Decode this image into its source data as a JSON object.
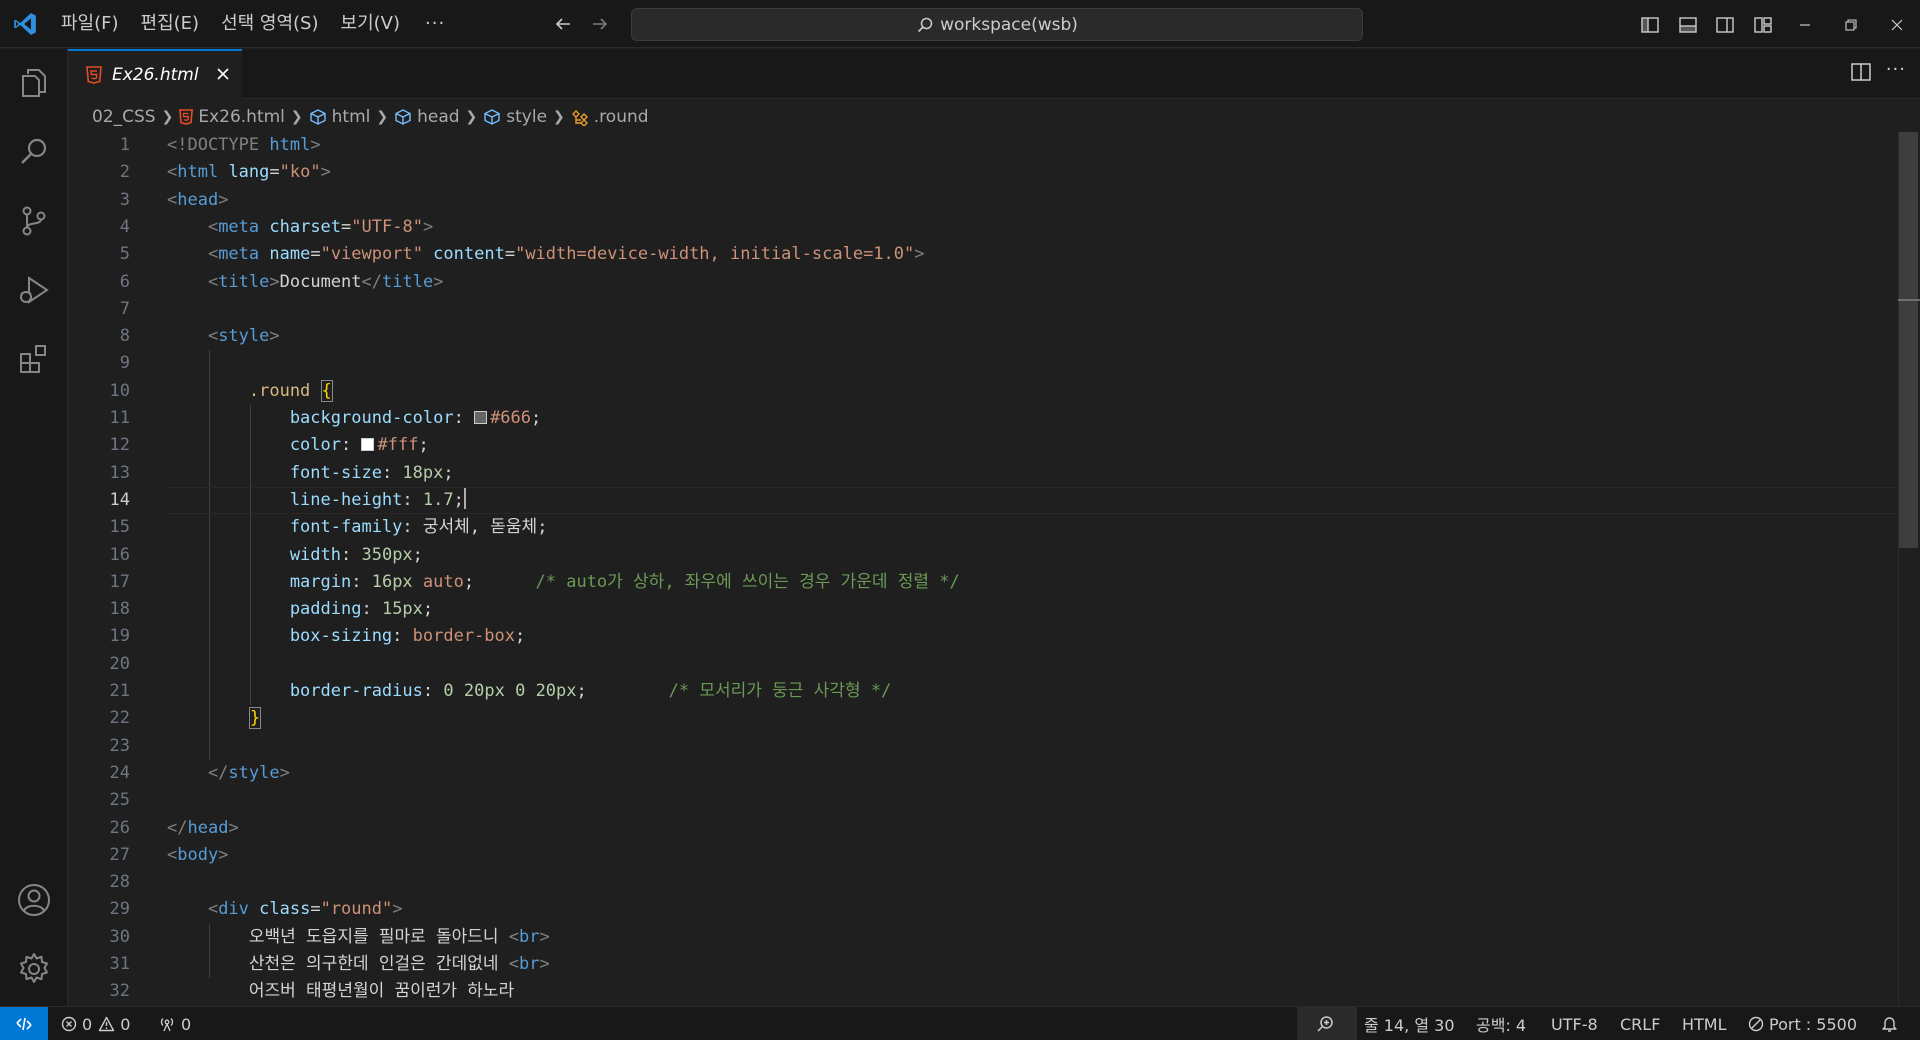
{
  "app": {
    "menus": [
      "파일(F)",
      "편집(E)",
      "선택 영역(S)",
      "보기(V)"
    ],
    "more": "···",
    "search_text": "workspace(wsb)"
  },
  "tab": {
    "label": "Ex26.html",
    "more": "···"
  },
  "breadcrumb": {
    "folder": "02_CSS",
    "file": "Ex26.html",
    "html": "html",
    "head": "head",
    "style": "style",
    "selector": ".round"
  },
  "editor": {
    "active_line": 14,
    "lines": [
      [
        [
          "<!DOCTYPE ",
          "t-br"
        ],
        [
          "html",
          "t-tag"
        ],
        [
          ">",
          "t-br"
        ]
      ],
      [
        [
          "<",
          "t-br"
        ],
        [
          "html",
          "t-tag"
        ],
        [
          " lang",
          "t-attr"
        ],
        [
          "=",
          "t-text"
        ],
        [
          "\"ko\"",
          "t-str"
        ],
        [
          ">",
          "t-br"
        ]
      ],
      [
        [
          "<",
          "t-br"
        ],
        [
          "head",
          "t-tag"
        ],
        [
          ">",
          "t-br"
        ]
      ],
      [
        [
          "    <",
          "t-br"
        ],
        [
          "meta",
          "t-tag"
        ],
        [
          " charset",
          "t-attr"
        ],
        [
          "=",
          "t-text"
        ],
        [
          "\"UTF-8\"",
          "t-str"
        ],
        [
          ">",
          "t-br"
        ]
      ],
      [
        [
          "    <",
          "t-br"
        ],
        [
          "meta",
          "t-tag"
        ],
        [
          " name",
          "t-attr"
        ],
        [
          "=",
          "t-text"
        ],
        [
          "\"viewport\"",
          "t-str"
        ],
        [
          " content",
          "t-attr"
        ],
        [
          "=",
          "t-text"
        ],
        [
          "\"width=device-width, initial-scale=1.0\"",
          "t-str"
        ],
        [
          ">",
          "t-br"
        ]
      ],
      [
        [
          "    <",
          "t-br"
        ],
        [
          "title",
          "t-tag"
        ],
        [
          ">",
          "t-br"
        ],
        [
          "Document",
          "t-text"
        ],
        [
          "</",
          "t-br"
        ],
        [
          "title",
          "t-tag"
        ],
        [
          ">",
          "t-br"
        ]
      ],
      [],
      [
        [
          "    <",
          "t-br"
        ],
        [
          "style",
          "t-tag"
        ],
        [
          ">",
          "t-br"
        ]
      ],
      [],
      [
        [
          "        .round ",
          "t-sel"
        ],
        [
          "{",
          "t-brace t-brace-box"
        ]
      ],
      [
        [
          "            background-color",
          "t-prop"
        ],
        [
          ": ",
          "t-text"
        ],
        [
          "",
          "swatch:#666666"
        ],
        [
          "#666",
          "t-str"
        ],
        [
          ";",
          "t-text"
        ]
      ],
      [
        [
          "            color",
          "t-prop"
        ],
        [
          ": ",
          "t-text"
        ],
        [
          "",
          "swatch:#ffffff"
        ],
        [
          "#fff",
          "t-str"
        ],
        [
          ";",
          "t-text"
        ]
      ],
      [
        [
          "            font-size",
          "t-prop"
        ],
        [
          ": ",
          "t-text"
        ],
        [
          "18px",
          "t-num"
        ],
        [
          ";",
          "t-text"
        ]
      ],
      [
        [
          "            line-height",
          "t-prop"
        ],
        [
          ": ",
          "t-text"
        ],
        [
          "1.7",
          "t-num"
        ],
        [
          ";",
          "t-text"
        ],
        [
          "",
          "cursor"
        ]
      ],
      [
        [
          "            font-family",
          "t-prop"
        ],
        [
          ": ",
          "t-text"
        ],
        [
          "궁서체, 돋움체",
          "t-text"
        ],
        [
          ";",
          "t-text"
        ]
      ],
      [
        [
          "            width",
          "t-prop"
        ],
        [
          ": ",
          "t-text"
        ],
        [
          "350px",
          "t-num"
        ],
        [
          ";",
          "t-text"
        ]
      ],
      [
        [
          "            margin",
          "t-prop"
        ],
        [
          ": ",
          "t-text"
        ],
        [
          "16px",
          "t-num"
        ],
        [
          " auto",
          "t-str"
        ],
        [
          ";",
          "t-text"
        ],
        [
          "      /* auto가 상하, 좌우에 쓰이는 경우 가운데 정렬 */",
          "t-cmt"
        ]
      ],
      [
        [
          "            padding",
          "t-prop"
        ],
        [
          ": ",
          "t-text"
        ],
        [
          "15px",
          "t-num"
        ],
        [
          ";",
          "t-text"
        ]
      ],
      [
        [
          "            box-sizing",
          "t-prop"
        ],
        [
          ": ",
          "t-text"
        ],
        [
          "border-box",
          "t-str"
        ],
        [
          ";",
          "t-text"
        ]
      ],
      [],
      [
        [
          "            border-radius",
          "t-prop"
        ],
        [
          ": ",
          "t-text"
        ],
        [
          "0",
          "t-num"
        ],
        [
          " ",
          "t-text"
        ],
        [
          "20px",
          "t-num"
        ],
        [
          " ",
          "t-text"
        ],
        [
          "0",
          "t-num"
        ],
        [
          " ",
          "t-text"
        ],
        [
          "20px",
          "t-num"
        ],
        [
          ";",
          "t-text"
        ],
        [
          "        /* 모서리가 둥근 사각형 */",
          "t-cmt"
        ]
      ],
      [
        [
          "        ",
          "t-text"
        ],
        [
          "}",
          "t-brace t-brace-box"
        ]
      ],
      [],
      [
        [
          "    </",
          "t-br"
        ],
        [
          "style",
          "t-tag"
        ],
        [
          ">",
          "t-br"
        ]
      ],
      [],
      [
        [
          "</",
          "t-br"
        ],
        [
          "head",
          "t-tag"
        ],
        [
          ">",
          "t-br"
        ]
      ],
      [
        [
          "<",
          "t-br"
        ],
        [
          "body",
          "t-tag"
        ],
        [
          ">",
          "t-br"
        ]
      ],
      [],
      [
        [
          "    <",
          "t-br"
        ],
        [
          "div",
          "t-tag"
        ],
        [
          " class",
          "t-attr"
        ],
        [
          "=",
          "t-text"
        ],
        [
          "\"round\"",
          "t-str"
        ],
        [
          ">",
          "t-br"
        ]
      ],
      [
        [
          "        오백년 도읍지를 필마로 돌아드니 ",
          "t-text"
        ],
        [
          "<",
          "t-br"
        ],
        [
          "br",
          "t-tag"
        ],
        [
          ">",
          "t-br"
        ]
      ],
      [
        [
          "        산천은 의구한데 인걸은 간데없네 ",
          "t-text"
        ],
        [
          "<",
          "t-br"
        ],
        [
          "br",
          "t-tag"
        ],
        [
          ">",
          "t-br"
        ]
      ],
      [
        [
          "        어즈버 태평년월이 꿈이런가 하노라",
          "t-text"
        ]
      ]
    ]
  },
  "status": {
    "errors": "0",
    "warnings": "0",
    "ports": "0",
    "position": "줄 14, 열 30",
    "spaces": "공백: 4",
    "encoding": "UTF-8",
    "eol": "CRLF",
    "language": "HTML",
    "port": "Port : 5500"
  },
  "colors": {
    "accent": "#0078d4",
    "background": "#1f1f1f",
    "html_icon": "#e44d26",
    "selector_icon": "#ee9d28"
  },
  "icons": [
    "vscode-logo-icon",
    "arrow-left-icon",
    "arrow-right-icon",
    "search-icon",
    "files-icon",
    "source-control-icon",
    "run-debug-icon",
    "extensions-icon",
    "account-icon",
    "settings-gear-icon",
    "html-file-icon",
    "symbol-class-icon",
    "remote-icon",
    "error-icon",
    "warning-icon",
    "broadcast-icon",
    "zoom-icon",
    "no-entry-icon",
    "bell-icon"
  ]
}
